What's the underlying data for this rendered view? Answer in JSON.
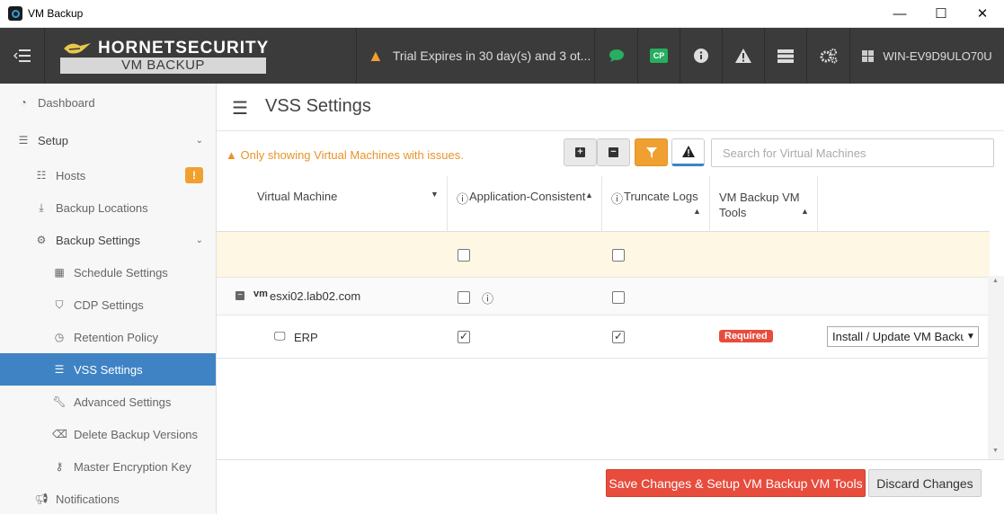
{
  "window": {
    "title": "VM Backup",
    "minimize": "—",
    "maximize": "☐",
    "close": "✕"
  },
  "header": {
    "brand_top": "HORNETSECURITY",
    "brand_bottom": "VM BACKUP",
    "trial_text": "Trial Expires in 30 day(s) and 3 ot...",
    "cp_label": "CP",
    "host_name": "WIN-EV9D9ULO70U"
  },
  "sidebar": {
    "items": [
      {
        "label": "Dashboard"
      },
      {
        "label": "Setup"
      },
      {
        "label": "Hosts",
        "badge": "!"
      },
      {
        "label": "Backup Locations"
      },
      {
        "label": "Backup Settings"
      },
      {
        "label": "Schedule Settings"
      },
      {
        "label": "CDP Settings"
      },
      {
        "label": "Retention Policy"
      },
      {
        "label": "VSS Settings"
      },
      {
        "label": "Advanced Settings"
      },
      {
        "label": "Delete Backup Versions"
      },
      {
        "label": "Master Encryption Key"
      },
      {
        "label": "Notifications"
      }
    ]
  },
  "page": {
    "title": "VSS Settings",
    "filter_message": "Only showing Virtual Machines with issues.",
    "search_placeholder": "Search for Virtual Machines"
  },
  "table": {
    "columns": {
      "vm": "Virtual Machine",
      "app_consistent": "Application-Consistent",
      "truncate_logs": "Truncate Logs",
      "vm_tools": "VM Backup VM Tools"
    },
    "host_row": {
      "tag": "vm",
      "name": "esxi02.lab02.com"
    },
    "vm_row": {
      "name": "ERP",
      "app_consistent": true,
      "truncate_logs": true,
      "status": "Required",
      "action": "Install / Update VM Backup VM Tools"
    }
  },
  "footer": {
    "save_label": "Save Changes & Setup VM Backup VM Tools",
    "discard_label": "Discard Changes"
  },
  "colors": {
    "accent": "#3f83c5",
    "danger": "#e74c3c",
    "warning": "#f0a030",
    "header": "#3b3b3b"
  }
}
